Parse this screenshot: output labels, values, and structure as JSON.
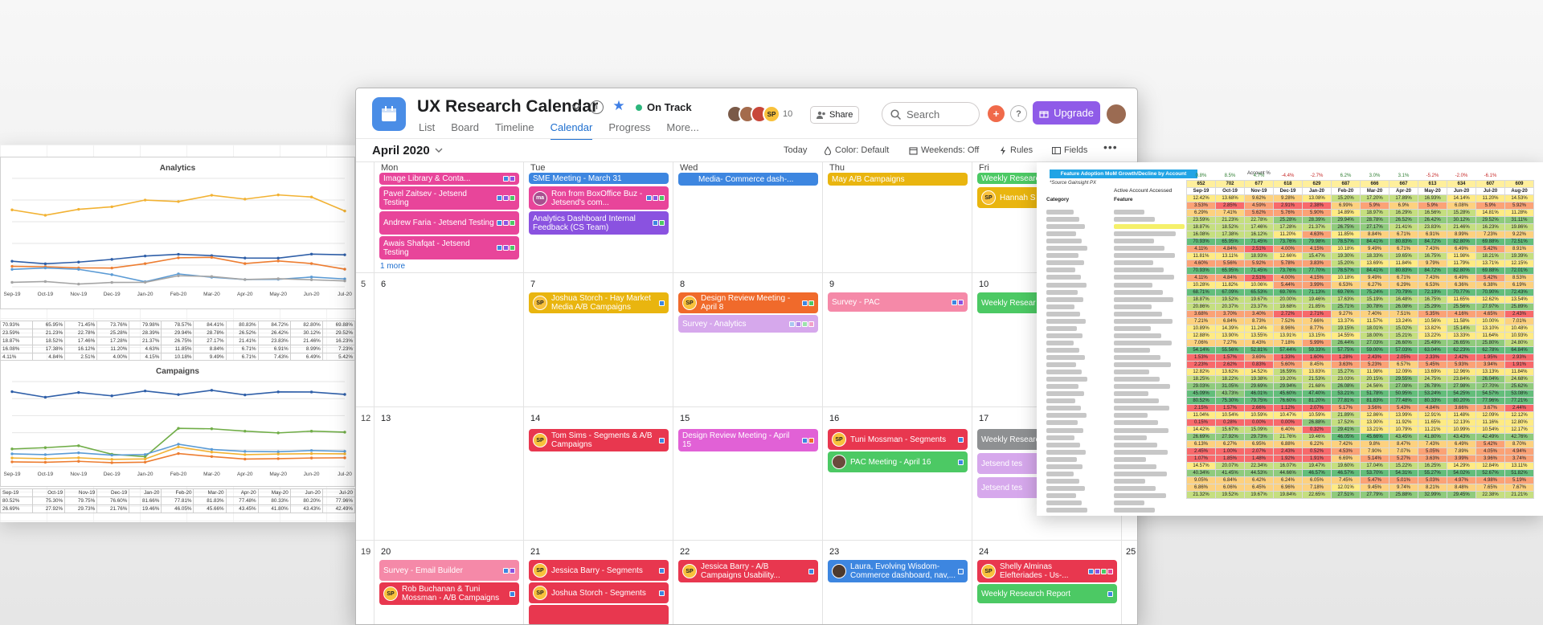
{
  "left_sheet": {
    "months": [
      "Sep-19",
      "Oct-19",
      "Nov-19",
      "Dec-19",
      "Jan-20",
      "Feb-20",
      "Mar-20",
      "Apr-20",
      "May-20",
      "Jun-20",
      "Jul-20"
    ],
    "chart_data": [
      {
        "type": "line",
        "title": "Analytics",
        "x": [
          "Sep-19",
          "Oct-19",
          "Nov-19",
          "Dec-19",
          "Jan-20",
          "Feb-20",
          "Mar-20",
          "Apr-20",
          "May-20",
          "Jun-20",
          "Jul-20"
        ],
        "series": [
          {
            "color": "#f2b233",
            "values": [
              70.93,
              65.95,
              71.45,
              73.76,
              79.98,
              78.57,
              84.41,
              80.83,
              84.72,
              82.8,
              69.88
            ]
          },
          {
            "color": "#2f5fa8",
            "values": [
              23.59,
              21.23,
              22.78,
              25.28,
              28.39,
              29.94,
              28.78,
              26.52,
              26.42,
              30.12,
              29.52
            ]
          },
          {
            "color": "#ed7d31",
            "values": [
              18.87,
              18.52,
              17.46,
              17.28,
              21.37,
              26.75,
              27.17,
              21.41,
              23.83,
              21.46,
              16.23
            ]
          },
          {
            "color": "#5b9bd5",
            "values": [
              16.08,
              17.38,
              16.12,
              11.2,
              4.63,
              11.85,
              8.84,
              6.71,
              6.91,
              8.99,
              7.23
            ]
          },
          {
            "color": "#a5a5a5",
            "values": [
              4.11,
              4.84,
              2.51,
              4.0,
              4.15,
              10.18,
              9.49,
              6.71,
              7.43,
              6.49,
              5.42
            ]
          }
        ],
        "rows": [
          [
            "70.93%",
            "65.95%",
            "71.45%",
            "73.76%",
            "79.98%",
            "78.57%",
            "84.41%",
            "80.83%",
            "84.72%",
            "82.80%",
            "69.88%"
          ],
          [
            "23.59%",
            "21.23%",
            "22.78%",
            "25.28%",
            "28.39%",
            "29.94%",
            "28.78%",
            "26.52%",
            "26.42%",
            "30.12%",
            "29.52%"
          ],
          [
            "18.87%",
            "18.52%",
            "17.46%",
            "17.28%",
            "21.37%",
            "26.75%",
            "27.17%",
            "21.41%",
            "23.83%",
            "21.46%",
            "16.23%"
          ],
          [
            "16.08%",
            "17.38%",
            "16.12%",
            "11.20%",
            "4.63%",
            "11.85%",
            "8.84%",
            "6.71%",
            "6.91%",
            "8.99%",
            "7.23%"
          ],
          [
            "4.11%",
            "4.84%",
            "2.51%",
            "4.00%",
            "4.15%",
            "10.18%",
            "9.49%",
            "6.71%",
            "7.43%",
            "6.49%",
            "5.42%"
          ]
        ]
      },
      {
        "type": "line",
        "title": "Campaigns",
        "x": [
          "Sep-19",
          "Oct-19",
          "Nov-19",
          "Dec-19",
          "Jan-20",
          "Feb-20",
          "Mar-20",
          "Apr-20",
          "May-20",
          "Jun-20",
          "Jul-20"
        ],
        "series": [
          {
            "color": "#2f5fa8",
            "values": [
              80.52,
              75.3,
              79.75,
              76.6,
              81.2,
              77.81,
              81.83,
              77.48,
              80.33,
              80.2,
              77.96
            ]
          },
          {
            "color": "#70ad47",
            "values": [
              26.69,
              27.92,
              29.73,
              21.76,
              19.46,
              46.05,
              45.66,
              43.45,
              41.8,
              43.43,
              42.49
            ]
          },
          {
            "color": "#5b9bd5",
            "values": [
              22.1,
              21.4,
              23.1,
              20.9,
              21.5,
              31.2,
              26.3,
              24.4,
              24.1,
              25.2,
              24.5
            ]
          },
          {
            "color": "#f2b233",
            "values": [
              18.2,
              17.6,
              18.4,
              16.9,
              17.3,
              28.6,
              23.8,
              21.4,
              21.9,
              22.3,
              22.1
            ]
          },
          {
            "color": "#ed7d31",
            "values": [
              14.6,
              14.2,
              15.1,
              13.8,
              14.3,
              22.4,
              19.6,
              17.2,
              17.6,
              18.2,
              18.4
            ]
          }
        ],
        "rows": [
          [
            "Sep-19",
            "Oct-19",
            "Nov-19",
            "Dec-19",
            "Jan-20",
            "Feb-20",
            "Mar-20",
            "Apr-20",
            "May-20",
            "Jun-20",
            "Jul-20"
          ],
          [
            "80.52%",
            "75.30%",
            "79.75%",
            "76.60%",
            "81.66%",
            "77.81%",
            "81.83%",
            "77.48%",
            "80.33%",
            "80.20%",
            "77.96%"
          ],
          [
            "26.69%",
            "27.92%",
            "29.73%",
            "21.76%",
            "19.46%",
            "46.05%",
            "45.66%",
            "43.45%",
            "41.80%",
            "43.43%",
            "42.49%"
          ]
        ]
      }
    ]
  },
  "project": {
    "title": "UX Research Calendar",
    "status": "On Track",
    "tabs": [
      "List",
      "Board",
      "Timeline",
      "Calendar",
      "Progress",
      "More..."
    ],
    "active_tab": "Calendar",
    "member_count": "10",
    "avatar_initials": "SP",
    "share_label": "Share",
    "search_placeholder": "Search",
    "upgrade_label": "Upgrade"
  },
  "toolbar": {
    "month": "April 2020",
    "today": "Today",
    "color": "Color: Default",
    "weekends": "Weekends: Off",
    "rules": "Rules",
    "fields": "Fields"
  },
  "calendar": {
    "days_of_week": [
      "Mon",
      "Tue",
      "Wed",
      "Thu",
      "Fri"
    ],
    "week_numbers": [
      "5",
      "12",
      "19"
    ],
    "day_numbers": [
      "6",
      "7",
      "8",
      "9",
      "10",
      "13",
      "14",
      "15",
      "16",
      "17",
      "20",
      "21",
      "22",
      "23",
      "24",
      "25"
    ],
    "more_label": "1 more",
    "events": {
      "mon1": [
        "Image Library & Conta...",
        "Pavel Zaitsev - Jetsend Testing",
        "Andrew Faria - Jetsend Testing",
        "Awais Shafqat - Jetsend Testing"
      ],
      "tue1": [
        "SME Meeting - March 31",
        "Ron from BoxOffice Buz - Jetsend's com...",
        "Analytics Dashboard Internal Feedback (CS Team)"
      ],
      "wed1": [
        "Media- Commerce dash-..."
      ],
      "thu1": [
        "May A/B Campaigns"
      ],
      "fri1": [
        "Weekly Research",
        "Hannah S"
      ],
      "tue7": "Joshua Storch - Hay Market Media A/B Campaigns",
      "wed8": [
        "Design Review Meeting - April 8",
        "Survey - Analytics"
      ],
      "thu9": "Survey - PAC",
      "fri10": "Weekly Resear",
      "tue14": "Tom Sims - Segments & A/B Campaigns",
      "wed15": "Design Review Meeting - April 15",
      "thu16": [
        "Tuni Mossman - Segments",
        "PAC Meeting - April 16"
      ],
      "fri17": [
        "Weekly Researc",
        "Jetsend tes",
        "Jetsend tes"
      ],
      "mon20": [
        "Survey - Email Builder",
        "Rob Buchanan & Tuni Mossman - A/B Campaigns"
      ],
      "tue21": [
        "Jessica Barry - Segments",
        "Joshua Storch - Segments"
      ],
      "wed22": "Jessica Barry - A/B Campaigns Usability...",
      "thu23": "Laura, Evolving Wisdom- Commerce dashboard, nav,...",
      "fri24": [
        "Shelly Alminas Elefteriades - Us-...",
        "Weekly Research Report"
      ]
    },
    "colors": {
      "pink": "#e8459a",
      "purple": "#8a52e0",
      "blue": "#3d86e0",
      "yellow": "#e9b50f",
      "orange": "#f06a2b",
      "lavender": "#d6a8ec",
      "rose": "#f589a8",
      "green": "#4cc964",
      "red": "#e8374f",
      "gray": "#8e9092",
      "magenta": "#e161d6"
    }
  },
  "right_sheet": {
    "title": "Feature Adoption MoM Growth/Decline by Account",
    "source": "*Source Gainsight PX",
    "account_label": "Account %",
    "active_label": "Active Account Accessed",
    "category_header": "Category",
    "feature_header": "Feature",
    "growth": [
      "0.8%",
      "8.5%",
      "4.7%",
      "-4.4%",
      "-2.7%",
      "6.2%",
      "3.0%",
      "3.1%",
      "-5.2%",
      "-2.0%",
      "-6.1%",
      ""
    ],
    "counts": [
      "652",
      "702",
      "677",
      "618",
      "629",
      "687",
      "666",
      "667",
      "613",
      "634",
      "607",
      "609"
    ],
    "months": [
      "Sep-19",
      "Oct-19",
      "Nov-19",
      "Dec-19",
      "Jan-20",
      "Feb-20",
      "Mar-20",
      "Apr-20",
      "May-20",
      "Jun-20",
      "Jul-20",
      "Aug-20"
    ],
    "rows": [
      [
        "12.42%",
        "13.68%",
        "9.62%",
        "9.28%",
        "13.08%",
        "15.20%",
        "17.20%",
        "17.89%",
        "16.93%",
        "14.14%",
        "11.20%",
        "14.53%"
      ],
      [
        "3.53%",
        "2.85%",
        "4.59%",
        "2.91%",
        "2.38%",
        "6.99%",
        "5.9%",
        "6.9%",
        "5.9%",
        "6.08%",
        "5.9%",
        "5.92%"
      ],
      [
        "6.29%",
        "7.41%",
        "5.62%",
        "5.76%",
        "5.90%",
        "14.89%",
        "18.97%",
        "16.29%",
        "16.56%",
        "15.28%",
        "14.81%",
        "11.28%"
      ],
      [
        "23.59%",
        "21.23%",
        "22.78%",
        "25.28%",
        "28.39%",
        "29.94%",
        "28.78%",
        "26.52%",
        "26.42%",
        "30.12%",
        "29.52%",
        "31.11%"
      ],
      [
        "18.87%",
        "18.52%",
        "17.46%",
        "17.28%",
        "21.37%",
        "26.75%",
        "27.17%",
        "21.41%",
        "23.83%",
        "21.46%",
        "16.23%",
        "19.86%"
      ],
      [
        "16.08%",
        "17.38%",
        "16.12%",
        "11.20%",
        "4.63%",
        "11.85%",
        "8.84%",
        "6.71%",
        "6.91%",
        "8.99%",
        "7.23%",
        "9.22%"
      ],
      [
        "70.93%",
        "65.95%",
        "71.45%",
        "73.76%",
        "79.98%",
        "78.57%",
        "84.41%",
        "80.83%",
        "84.72%",
        "82.80%",
        "69.88%",
        "72.51%"
      ],
      [
        "4.11%",
        "4.84%",
        "2.51%",
        "4.00%",
        "4.15%",
        "10.18%",
        "9.49%",
        "6.71%",
        "7.43%",
        "6.49%",
        "5.42%",
        "8.91%"
      ],
      [
        "11.81%",
        "13.11%",
        "18.93%",
        "12.66%",
        "15.47%",
        "19.30%",
        "18.33%",
        "19.65%",
        "16.75%",
        "11.98%",
        "18.21%",
        "19.39%"
      ],
      [
        "4.60%",
        "5.56%",
        "5.92%",
        "5.78%",
        "3.83%",
        "15.20%",
        "13.69%",
        "11.84%",
        "9.79%",
        "11.79%",
        "13.71%",
        "12.15%"
      ],
      [
        "70.93%",
        "65.95%",
        "71.45%",
        "73.76%",
        "77.70%",
        "78.57%",
        "84.41%",
        "80.83%",
        "84.72%",
        "82.80%",
        "69.88%",
        "72.01%"
      ],
      [
        "4.11%",
        "4.84%",
        "2.51%",
        "4.00%",
        "4.15%",
        "10.18%",
        "9.49%",
        "6.71%",
        "7.43%",
        "6.49%",
        "5.42%",
        "8.53%"
      ],
      [
        "10.28%",
        "11.82%",
        "10.06%",
        "5.44%",
        "3.99%",
        "6.53%",
        "6.27%",
        "6.29%",
        "6.53%",
        "6.36%",
        "6.38%",
        "6.19%"
      ],
      [
        "68.71%",
        "67.09%",
        "65.53%",
        "69.76%",
        "71.13%",
        "69.76%",
        "75.24%",
        "70.79%",
        "72.19%",
        "70.77%",
        "70.90%",
        "72.43%"
      ],
      [
        "18.87%",
        "19.52%",
        "19.67%",
        "20.00%",
        "19.46%",
        "17.63%",
        "15.19%",
        "16.48%",
        "16.75%",
        "11.65%",
        "12.62%",
        "13.54%"
      ],
      [
        "20.86%",
        "20.37%",
        "23.37%",
        "19.68%",
        "21.85%",
        "25.71%",
        "30.78%",
        "26.08%",
        "25.29%",
        "25.56%",
        "27.97%",
        "25.89%"
      ],
      [
        "3.68%",
        "3.70%",
        "3.40%",
        "2.72%",
        "2.71%",
        "9.27%",
        "7.40%",
        "7.51%",
        "5.35%",
        "4.16%",
        "4.65%",
        "2.43%"
      ],
      [
        "7.21%",
        "6.84%",
        "8.73%",
        "7.52%",
        "7.66%",
        "13.37%",
        "11.57%",
        "13.24%",
        "10.56%",
        "11.58%",
        "10.00%",
        "7.01%"
      ],
      [
        "10.89%",
        "14.39%",
        "11.24%",
        "8.96%",
        "8.77%",
        "19.15%",
        "18.01%",
        "15.02%",
        "13.82%",
        "15.14%",
        "13.10%",
        "10.48%"
      ],
      [
        "12.88%",
        "13.90%",
        "13.55%",
        "13.91%",
        "13.15%",
        "14.55%",
        "18.00%",
        "15.21%",
        "13.22%",
        "13.33%",
        "11.64%",
        "10.93%"
      ],
      [
        "7.06%",
        "7.27%",
        "8.43%",
        "7.18%",
        "5.99%",
        "26.44%",
        "27.03%",
        "26.60%",
        "25.49%",
        "26.65%",
        "25.80%",
        "24.80%"
      ],
      [
        "54.14%",
        "55.56%",
        "52.81%",
        "57.44%",
        "59.33%",
        "57.75%",
        "59.00%",
        "57.03%",
        "63.04%",
        "62.23%",
        "62.78%",
        "64.84%"
      ],
      [
        "1.53%",
        "1.57%",
        "3.69%",
        "1.33%",
        "1.60%",
        "1.28%",
        "2.43%",
        "2.05%",
        "2.33%",
        "2.42%",
        "1.95%",
        "2.93%"
      ],
      [
        "2.23%",
        "2.62%",
        "0.83%",
        "5.60%",
        "8.45%",
        "3.63%",
        "5.23%",
        "6.57%",
        "5.45%",
        "5.93%",
        "3.94%",
        "1.91%"
      ],
      [
        "12.82%",
        "13.62%",
        "14.52%",
        "16.59%",
        "13.83%",
        "15.27%",
        "11.98%",
        "12.09%",
        "13.69%",
        "12.96%",
        "13.13%",
        "11.84%"
      ],
      [
        "18.25%",
        "18.22%",
        "19.38%",
        "19.20%",
        "21.53%",
        "23.03%",
        "20.15%",
        "29.55%",
        "24.75%",
        "23.84%",
        "26.04%",
        "24.68%"
      ],
      [
        "29.03%",
        "31.05%",
        "29.69%",
        "29.94%",
        "21.68%",
        "26.08%",
        "24.56%",
        "27.08%",
        "26.78%",
        "27.98%",
        "27.70%",
        "25.62%"
      ],
      [
        "45.09%",
        "43.73%",
        "46.01%",
        "45.60%",
        "47.40%",
        "53.21%",
        "51.78%",
        "50.95%",
        "53.24%",
        "54.25%",
        "54.57%",
        "53.08%"
      ],
      [
        "80.52%",
        "75.30%",
        "79.75%",
        "76.60%",
        "81.20%",
        "77.81%",
        "81.83%",
        "77.48%",
        "80.33%",
        "80.20%",
        "77.96%",
        "77.21%"
      ],
      [
        "2.15%",
        "1.57%",
        "2.66%",
        "1.12%",
        "2.07%",
        "5.17%",
        "3.56%",
        "5.43%",
        "4.84%",
        "3.66%",
        "3.67%",
        "2.44%"
      ],
      [
        "11.04%",
        "10.54%",
        "10.59%",
        "10.47%",
        "10.59%",
        "21.89%",
        "12.86%",
        "13.99%",
        "12.91%",
        "11.48%",
        "12.09%",
        "12.12%"
      ],
      [
        "0.15%",
        "0.28%",
        "0.00%",
        "0.00%",
        "26.88%",
        "17.52%",
        "13.90%",
        "11.92%",
        "11.65%",
        "12.13%",
        "11.16%",
        "12.80%"
      ],
      [
        "14.42%",
        "15.67%",
        "15.09%",
        "6.40%",
        "0.32%",
        "29.41%",
        "13.21%",
        "10.79%",
        "11.21%",
        "10.99%",
        "10.54%",
        "12.17%"
      ],
      [
        "26.69%",
        "27.92%",
        "29.73%",
        "21.76%",
        "19.46%",
        "46.05%",
        "45.66%",
        "43.45%",
        "41.80%",
        "43.43%",
        "42.49%",
        "42.76%"
      ],
      [
        "6.13%",
        "6.27%",
        "6.95%",
        "6.88%",
        "6.22%",
        "7.42%",
        "9.8%",
        "8.47%",
        "7.43%",
        "6.49%",
        "5.42%",
        "8.70%"
      ],
      [
        "2.45%",
        "1.00%",
        "2.07%",
        "2.43%",
        "0.52%",
        "4.53%",
        "7.90%",
        "7.07%",
        "5.05%",
        "7.89%",
        "4.05%",
        "4.94%"
      ],
      [
        "1.07%",
        "1.85%",
        "1.48%",
        "1.92%",
        "1.91%",
        "6.69%",
        "5.14%",
        "5.27%",
        "3.63%",
        "3.99%",
        "3.96%",
        "3.74%"
      ],
      [
        "14.57%",
        "20.07%",
        "22.34%",
        "16.07%",
        "19.47%",
        "19.60%",
        "17.04%",
        "15.22%",
        "16.25%",
        "14.29%",
        "12.84%",
        "13.11%"
      ],
      [
        "40.34%",
        "41.45%",
        "44.53%",
        "44.66%",
        "46.57%",
        "46.57%",
        "53.70%",
        "54.31%",
        "55.27%",
        "54.02%",
        "52.67%",
        "51.82%"
      ],
      [
        "9.05%",
        "6.84%",
        "6.42%",
        "6.24%",
        "6.05%",
        "7.45%",
        "5.47%",
        "5.01%",
        "5.03%",
        "4.97%",
        "4.98%",
        "5.19%"
      ],
      [
        "6.86%",
        "6.06%",
        "6.45%",
        "6.96%",
        "7.18%",
        "12.01%",
        "9.45%",
        "9.74%",
        "8.21%",
        "8.48%",
        "7.65%",
        "7.67%"
      ],
      [
        "21.32%",
        "19.52%",
        "19.67%",
        "19.84%",
        "22.65%",
        "27.51%",
        "27.79%",
        "25.88%",
        "32.99%",
        "29.45%",
        "22.38%",
        "21.21%"
      ]
    ]
  }
}
